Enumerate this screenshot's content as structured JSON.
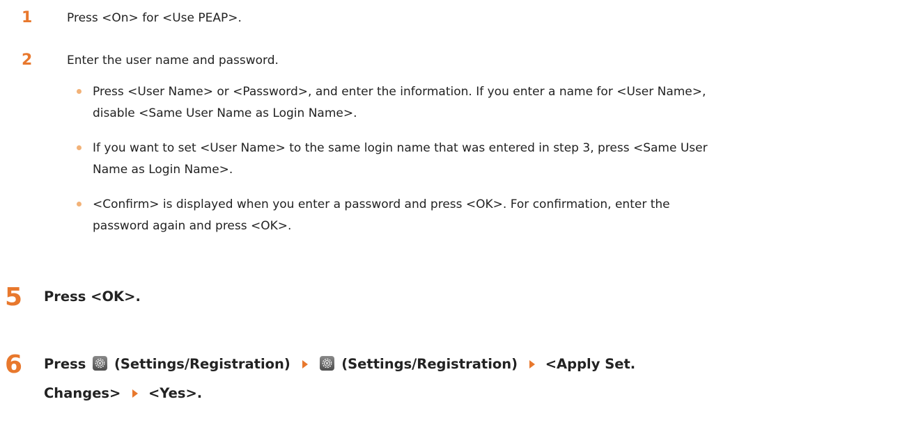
{
  "colors": {
    "accent": "#e8782d",
    "bullet": "#f2b278",
    "text": "#222222"
  },
  "substeps": [
    {
      "number": "1",
      "text": "Press <On> for <Use PEAP>."
    },
    {
      "number": "2",
      "text": "Enter the user name and password."
    }
  ],
  "bullets": [
    {
      "line1": "Press <User Name> or <Password>, and enter the information. If you enter a name for <User Name>,",
      "line2": "disable <Same User Name as Login Name>."
    },
    {
      "line1": "If you want to set <User Name> to the same login name that was entered in step 3, press <Same User",
      "line2": "Name as Login Name>."
    },
    {
      "line1": "<Confirm> is displayed when you enter a password and press <OK>. For confirmation, enter the",
      "line2": "password again and press <OK>."
    }
  ],
  "step5": {
    "number": "5",
    "text": "Press <OK>."
  },
  "step6": {
    "number": "6",
    "press": "Press",
    "settings_label_1": "(Settings/Registration)",
    "settings_label_2": "(Settings/Registration)",
    "apply_label": "<Apply Set.",
    "apply_label_cont": "Changes>",
    "yes_label": "<Yes>.",
    "icons": [
      "settings-registration-icon",
      "arrow-right-icon"
    ]
  }
}
